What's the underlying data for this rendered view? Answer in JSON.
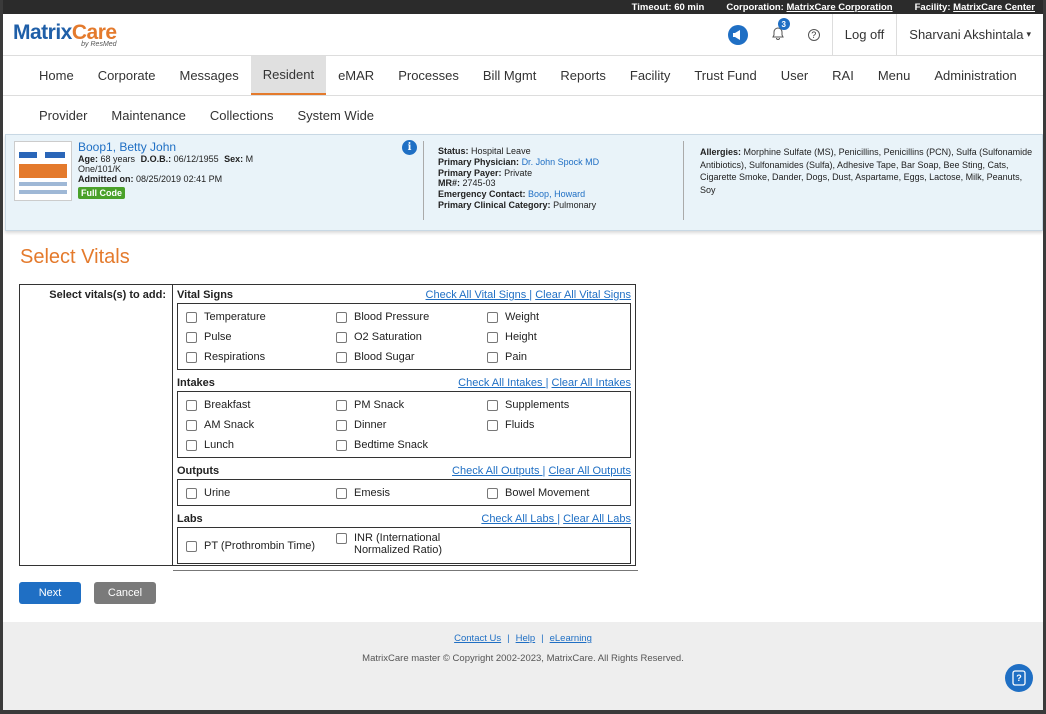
{
  "topbar": {
    "timeout": "Timeout: 60 min",
    "corporation_label": "Corporation:",
    "corporation_value": "MatrixCare Corporation",
    "facility_label": "Facility:",
    "facility_value": "MatrixCare Center"
  },
  "header": {
    "brand_a": "Matrix",
    "brand_b": "Care",
    "brand_sub": "by ResMed",
    "notification_count": "3",
    "help_symbol": "?",
    "logoff": "Log off",
    "user": "Sharvani Akshintala"
  },
  "nav_primary": [
    "Home",
    "Corporate",
    "Messages",
    "Resident",
    "eMAR",
    "Processes",
    "Bill Mgmt",
    "Reports",
    "Facility",
    "Trust Fund",
    "User",
    "RAI",
    "Menu",
    "Administration"
  ],
  "nav_secondary": [
    "Provider",
    "Maintenance",
    "Collections",
    "System Wide"
  ],
  "resident": {
    "name": "Boop1, Betty John",
    "age_label": "Age:",
    "age": "68 years",
    "dob_label": "D.O.B.:",
    "dob": "06/12/1955",
    "sex_label": "Sex:",
    "sex": "M",
    "room": "One/101/K",
    "admitted_label": "Admitted on:",
    "admitted": "08/25/2019 02:41 PM",
    "code_status": "Full Code",
    "status_label": "Status:",
    "status": "Hospital Leave",
    "physician_label": "Primary Physician:",
    "physician": "Dr. John Spock MD",
    "payer_label": "Primary Payer:",
    "payer": "Private",
    "mr_label": "MR#:",
    "mr": "2745-03",
    "emergency_label": "Emergency Contact:",
    "emergency": "Boop, Howard",
    "category_label": "Primary Clinical Category:",
    "category": "Pulmonary",
    "allergies_label": "Allergies:",
    "allergies": "Morphine Sulfate (MS), Penicillins, Penicillins (PCN), Sulfa (Sulfonamide Antibiotics), Sulfonamides (Sulfa), Adhesive Tape, Bar Soap, Bee Sting, Cats, Cigarette Smoke, Dander, Dogs, Dust, Aspartame, Eggs, Lactose, Milk, Peanuts, Soy"
  },
  "page": {
    "title": "Select Vitals",
    "select_label": "Select vitals(s) to add:"
  },
  "sections": {
    "vital_signs": {
      "title": "Vital Signs",
      "check_all": "Check All Vital Signs ",
      "clear_all": "Clear All Vital Signs",
      "items": [
        "Temperature",
        "Blood Pressure",
        "Weight",
        "Pulse",
        "O2 Saturation",
        "Height",
        "Respirations",
        "Blood Sugar",
        "Pain"
      ]
    },
    "intakes": {
      "title": "Intakes",
      "check_all": "Check All Intakes ",
      "clear_all": "Clear All Intakes",
      "items": [
        "Breakfast",
        "PM Snack",
        "Supplements",
        "AM Snack",
        "Dinner",
        "Fluids",
        "Lunch",
        "Bedtime Snack"
      ]
    },
    "outputs": {
      "title": "Outputs",
      "check_all": "Check All Outputs ",
      "clear_all": "Clear All Outputs",
      "items": [
        "Urine",
        "Emesis",
        "Bowel Movement"
      ]
    },
    "labs": {
      "title": "Labs",
      "check_all": "Check All Labs ",
      "clear_all": "Clear All Labs",
      "items": [
        "PT (Prothrombin Time)",
        "INR (International Normalized Ratio)"
      ]
    }
  },
  "buttons": {
    "next": "Next",
    "cancel": "Cancel"
  },
  "footer": {
    "contact": "Contact Us",
    "help": "Help",
    "elearning": "eLearning",
    "copyright": "MatrixCare master © Copyright 2002-2023, MatrixCare. All Rights Reserved."
  },
  "colors": {
    "accent": "#1f6fc4",
    "brand_orange": "#e47a2c",
    "active_tab": "#e0e0e0",
    "code_green": "#4aa12a"
  }
}
